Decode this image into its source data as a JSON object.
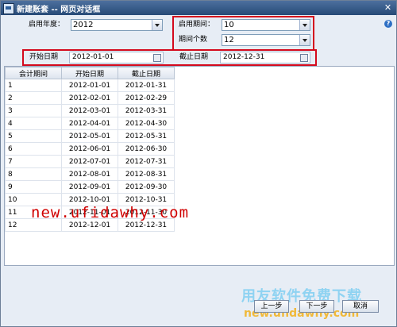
{
  "window": {
    "title": "新建账套 -- 网页对话框",
    "close_glyph": "✕",
    "help_glyph": "?"
  },
  "form": {
    "year_label": "启用年度：",
    "year_value": "2012",
    "period_label": "启用期间：",
    "period_value": "10",
    "period_count_label": "期间个数",
    "period_count_value": "12",
    "start_date_label": "开始日期",
    "start_date_value": "2012-01-01",
    "end_date_label": "截止日期",
    "end_date_value": "2012-12-31"
  },
  "grid": {
    "columns": [
      "会计期间",
      "开始日期",
      "截止日期"
    ],
    "rows": [
      [
        "1",
        "2012-01-01",
        "2012-01-31"
      ],
      [
        "2",
        "2012-02-01",
        "2012-02-29"
      ],
      [
        "3",
        "2012-03-01",
        "2012-03-31"
      ],
      [
        "4",
        "2012-04-01",
        "2012-04-30"
      ],
      [
        "5",
        "2012-05-01",
        "2012-05-31"
      ],
      [
        "6",
        "2012-06-01",
        "2012-06-30"
      ],
      [
        "7",
        "2012-07-01",
        "2012-07-31"
      ],
      [
        "8",
        "2012-08-01",
        "2012-08-31"
      ],
      [
        "9",
        "2012-09-01",
        "2012-09-30"
      ],
      [
        "10",
        "2012-10-01",
        "2012-10-31"
      ],
      [
        "11",
        "2012-11-01",
        "2012-11-30"
      ],
      [
        "12",
        "2012-12-01",
        "2012-12-31"
      ]
    ]
  },
  "buttons": {
    "prev": "上一步",
    "next": "下一步",
    "cancel": "取消"
  },
  "watermarks": {
    "url_red": "new.ufidawhy.com",
    "brand": "用友软件免费下载",
    "url_bottom": "new.ufidawhy.com"
  },
  "colors": {
    "highlight_red": "#d40a1d",
    "title_bar": "#274a77",
    "watermark_red": "#d00000"
  }
}
